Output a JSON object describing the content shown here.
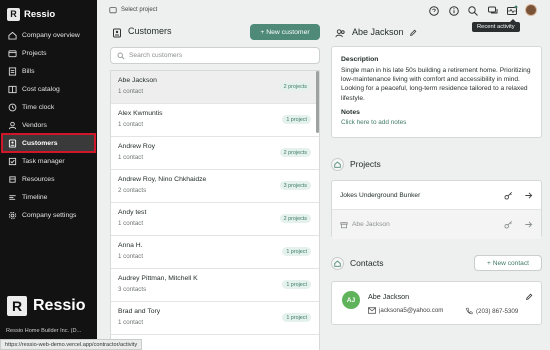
{
  "sidebar": {
    "brand": "Ressio",
    "brand_letter": "R",
    "items": [
      {
        "label": "Company overview",
        "icon": "home-icon"
      },
      {
        "label": "Projects",
        "icon": "folder-icon"
      },
      {
        "label": "Bills",
        "icon": "bill-icon"
      },
      {
        "label": "Cost catalog",
        "icon": "catalog-icon"
      },
      {
        "label": "Time clock",
        "icon": "clock-icon"
      },
      {
        "label": "Vendors",
        "icon": "vendor-icon"
      },
      {
        "label": "Customers",
        "icon": "customer-icon",
        "active": true
      },
      {
        "label": "Task manager",
        "icon": "task-icon"
      },
      {
        "label": "Resources",
        "icon": "resources-icon"
      },
      {
        "label": "Timeline",
        "icon": "timeline-icon"
      },
      {
        "label": "Company settings",
        "icon": "gear-icon"
      }
    ],
    "company": "Ressio Home Builder Inc. (D..."
  },
  "topbar": {
    "select_project": "Select project",
    "tooltip": "Recent activity"
  },
  "status_url": "https://ressio-web-demo.vercel.app/contractor/activity",
  "customers": {
    "title": "Customers",
    "new_button": "+ New customer",
    "search_placeholder": "Search customers",
    "rows": [
      {
        "name": "Abe Jackson",
        "contacts": "1 contact",
        "projects": "2 projects",
        "selected": true
      },
      {
        "name": "Alex Kwmuntis",
        "contacts": "1 contact",
        "projects": "1 project"
      },
      {
        "name": "Andrew Roy",
        "contacts": "1 contact",
        "projects": "2 projects"
      },
      {
        "name": "Andrew Roy, Nino Chkhaidze",
        "contacts": "2 contacts",
        "projects": "3 projects"
      },
      {
        "name": "Andy test",
        "contacts": "1 contact",
        "projects": "2 projects"
      },
      {
        "name": "Anna H.",
        "contacts": "1 contact",
        "projects": "1 project"
      },
      {
        "name": "Audrey Pittman, Mitchell K",
        "contacts": "3 contacts",
        "projects": "1 project"
      },
      {
        "name": "Brad and Tory",
        "contacts": "1 contact",
        "projects": "1 project"
      },
      {
        "name": "",
        "contacts": "",
        "projects": ""
      }
    ]
  },
  "detail": {
    "name": "Abe Jackson",
    "description_heading": "Description",
    "description": "Single man in his late 50s building a retirement home. Prioritizing low-maintenance living with comfort and accessibility in mind. Looking for a peaceful, long-term residence tailored to a relaxed lifestyle.",
    "notes_heading": "Notes",
    "notes_link": "Click here to add notes",
    "projects_heading": "Projects",
    "projects": [
      {
        "name": "Jokes Underground Bunker",
        "archived": false
      },
      {
        "name": "Abe Jackson",
        "archived": true
      }
    ],
    "contacts_heading": "Contacts",
    "new_contact": "+ New contact",
    "contact": {
      "initials": "AJ",
      "name": "Abe Jackson",
      "email": "jacksona5@yahoo.com",
      "phone": "(203) 867-5309"
    }
  },
  "colors": {
    "accent": "#4e8a77",
    "sidebar_bg": "#121212",
    "highlight": "#d0172a",
    "avatar": "#5fb35a"
  }
}
